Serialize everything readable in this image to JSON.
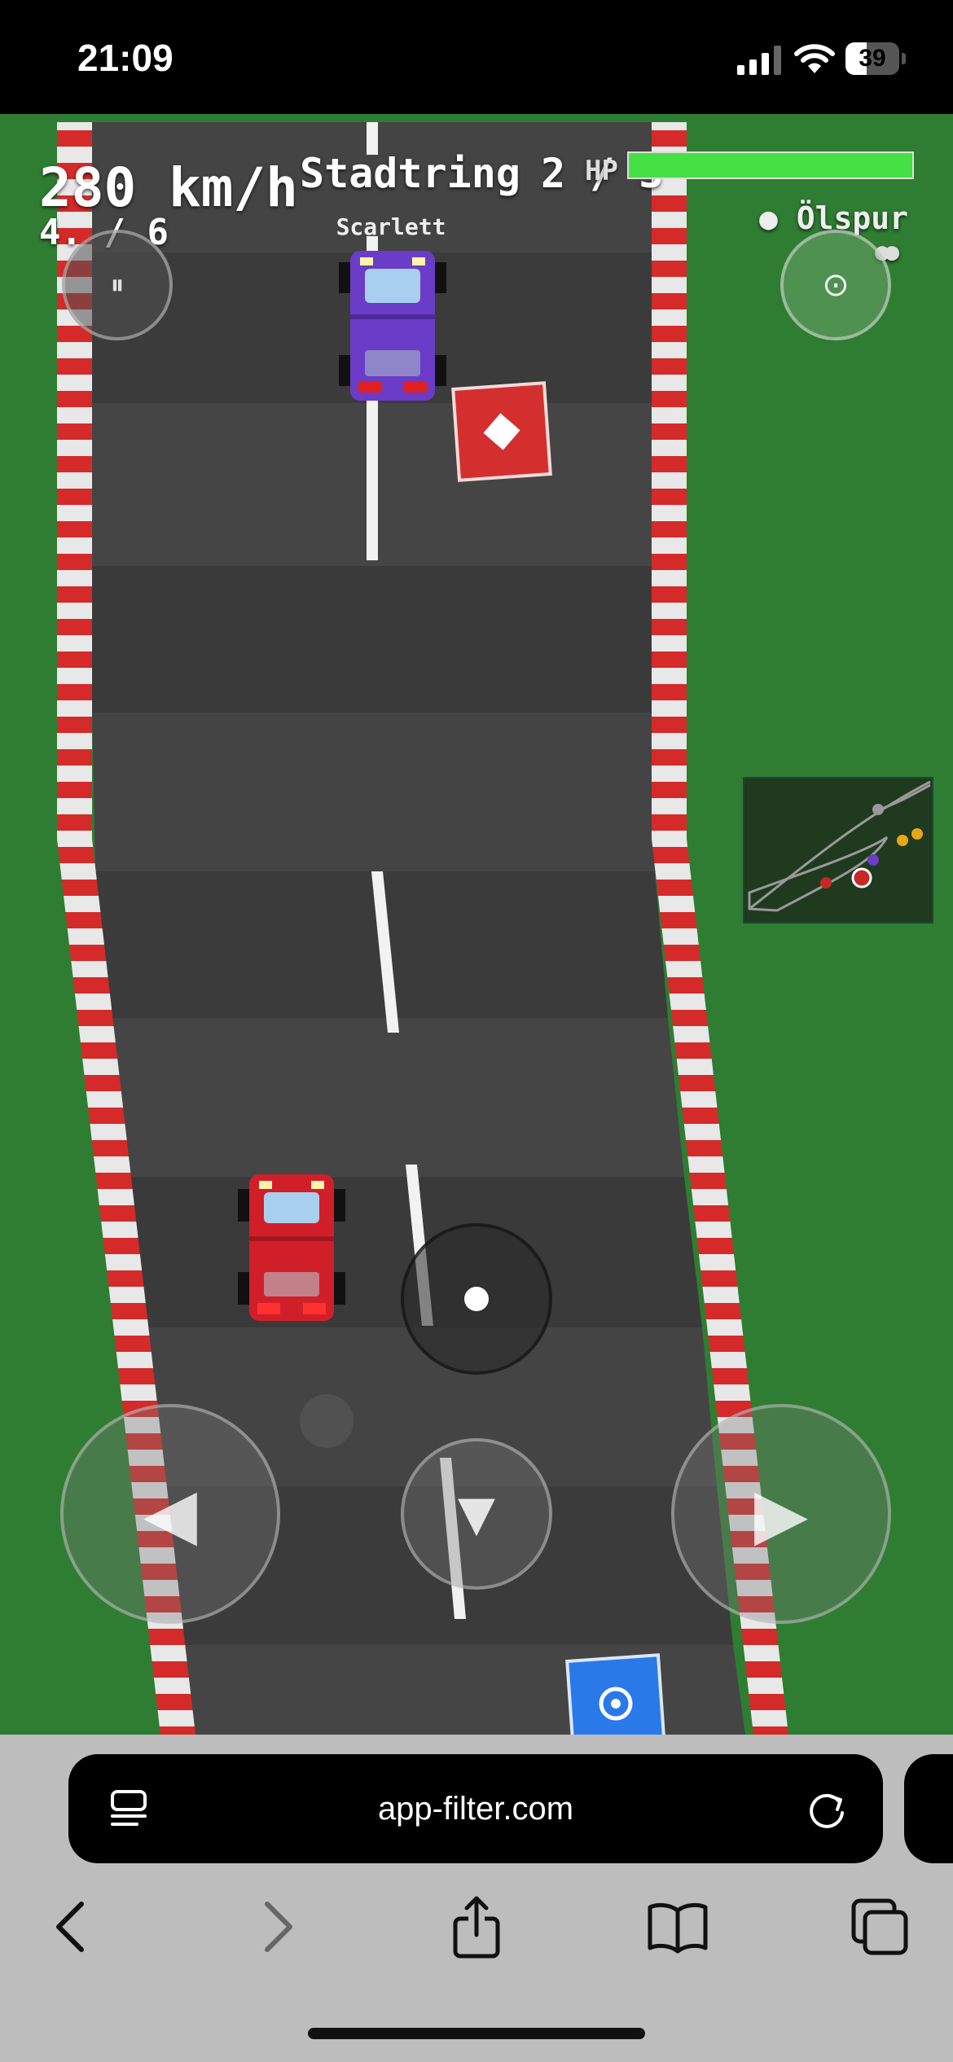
{
  "status_bar": {
    "time": "21:09",
    "battery_level": "39",
    "battery_fraction": 0.39,
    "icons": [
      "signal-icon",
      "wifi-icon",
      "battery-icon"
    ]
  },
  "hud": {
    "speed": "280 km/h",
    "position": "4. / 6",
    "track_name": "Stadtring",
    "lap": "2 / 3",
    "hp_label": "HP",
    "hp_fraction": 1.0,
    "hp_color": "#44e044",
    "active_effect": "● Ölspur",
    "indicator_dots": "●●"
  },
  "opponent": {
    "name": "Scarlett",
    "color": "#6a3cc8"
  },
  "player": {
    "color": "#d11f2a"
  },
  "controls": {
    "pause_icon": "⏸",
    "camera_icon": "⊙",
    "left_icon": "◀",
    "right_icon": "▶",
    "brake_icon": "▼",
    "icons": [
      "pause-icon",
      "camera-icon",
      "steer-left-icon",
      "steer-right-icon",
      "brake-icon"
    ]
  },
  "pickups": [
    {
      "type": "red-diamond",
      "symbol": "◆",
      "color": "#d32f2f"
    },
    {
      "type": "blue-target",
      "symbol": "◎",
      "color": "#2979e8"
    }
  ],
  "minimap": {
    "racer_colors": [
      "#999999",
      "#e6a817",
      "#e6a817",
      "#6a3cc8",
      "#c62828",
      "#c62828"
    ]
  },
  "browser": {
    "url": "app-filter.com",
    "icons": [
      "tabs-overview-icon",
      "reload-icon",
      "back-icon",
      "forward-icon",
      "share-icon",
      "bookmarks-icon",
      "tabs-icon"
    ]
  }
}
